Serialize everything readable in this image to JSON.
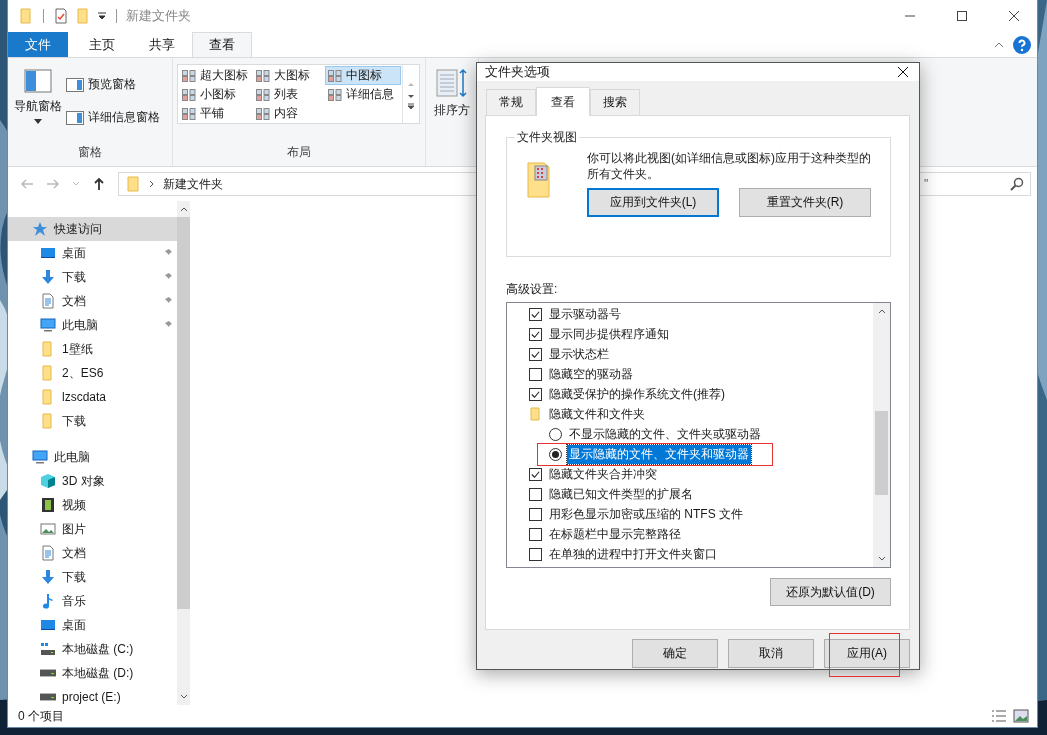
{
  "explorer": {
    "title": "新建文件夹",
    "ribbon_tabs": [
      {
        "label": "文件",
        "kind": "file",
        "selected": false
      },
      {
        "label": "主页",
        "kind": "tab",
        "selected": false
      },
      {
        "label": "共享",
        "kind": "tab",
        "selected": false
      },
      {
        "label": "查看",
        "kind": "tab",
        "selected": true
      }
    ],
    "panes_group": {
      "label": "窗格",
      "navigation_pane": "导航窗格",
      "items": [
        "预览窗格",
        "详细信息窗格"
      ]
    },
    "layout_group": {
      "label": "布局",
      "options": [
        {
          "label": "超大图标",
          "selected": false
        },
        {
          "label": "大图标",
          "selected": false
        },
        {
          "label": "中图标",
          "selected": true
        },
        {
          "label": "小图标",
          "selected": false
        },
        {
          "label": "列表",
          "selected": false
        },
        {
          "label": "详细信息",
          "selected": false
        },
        {
          "label": "平铺",
          "selected": false
        },
        {
          "label": "内容",
          "selected": false
        }
      ]
    },
    "sort_button": "排序方",
    "address": {
      "path": "新建文件夹"
    },
    "search": {
      "placeholder": "\""
    },
    "navigation": [
      {
        "label": "快速访问",
        "kind": "star",
        "selected": true,
        "pinned": false,
        "children": [
          {
            "label": "桌面",
            "kind": "desktop",
            "selected": false,
            "pinned": true
          },
          {
            "label": "下载",
            "kind": "download",
            "selected": false,
            "pinned": true
          },
          {
            "label": "文档",
            "kind": "document",
            "selected": false,
            "pinned": true
          },
          {
            "label": "此电脑",
            "kind": "pc",
            "selected": false,
            "pinned": true
          },
          {
            "label": "1壁纸",
            "kind": "folder",
            "selected": false,
            "pinned": false
          },
          {
            "label": "2、ES6",
            "kind": "folder",
            "selected": false,
            "pinned": false
          },
          {
            "label": "lzscdata",
            "kind": "folder",
            "selected": false,
            "pinned": false
          },
          {
            "label": "下载",
            "kind": "folder",
            "selected": false,
            "pinned": false
          }
        ]
      },
      {
        "label": "此电脑",
        "kind": "pc",
        "selected": false,
        "pinned": false,
        "children": [
          {
            "label": "3D 对象",
            "kind": "cube",
            "selected": false,
            "pinned": false
          },
          {
            "label": "视频",
            "kind": "video",
            "selected": false,
            "pinned": false
          },
          {
            "label": "图片",
            "kind": "picture",
            "selected": false,
            "pinned": false
          },
          {
            "label": "文档",
            "kind": "document",
            "selected": false,
            "pinned": false
          },
          {
            "label": "下载",
            "kind": "download",
            "selected": false,
            "pinned": false
          },
          {
            "label": "音乐",
            "kind": "music",
            "selected": false,
            "pinned": false
          },
          {
            "label": "桌面",
            "kind": "desktop",
            "selected": false,
            "pinned": false
          },
          {
            "label": "本地磁盘 (C:)",
            "kind": "system-drive",
            "selected": false,
            "pinned": false
          },
          {
            "label": "本地磁盘 (D:)",
            "kind": "drive",
            "selected": false,
            "pinned": false
          },
          {
            "label": "project (E:)",
            "kind": "drive",
            "selected": false,
            "pinned": false
          }
        ]
      }
    ],
    "status_bar": "0 个项目"
  },
  "dialog": {
    "title": "文件夹选项",
    "tabs": [
      {
        "label": "常规",
        "selected": false
      },
      {
        "label": "查看",
        "selected": true
      },
      {
        "label": "搜索",
        "selected": false
      }
    ],
    "folder_views": {
      "legend": "文件夹视图",
      "description": "你可以将此视图(如详细信息或图标)应用于这种类型的所有文件夹。",
      "buttons": [
        {
          "label": "应用到文件夹(L)",
          "focused": true
        },
        {
          "label": "重置文件夹(R)",
          "focused": false
        }
      ]
    },
    "advanced": {
      "label": "高级设置:",
      "items": [
        {
          "kind": "checkbox",
          "label": "显示驱动器号",
          "checked": true
        },
        {
          "kind": "checkbox",
          "label": "显示同步提供程序通知",
          "checked": true
        },
        {
          "kind": "checkbox",
          "label": "显示状态栏",
          "checked": true
        },
        {
          "kind": "checkbox",
          "label": "隐藏空的驱动器",
          "checked": false
        },
        {
          "kind": "checkbox",
          "label": "隐藏受保护的操作系统文件(推荐)",
          "checked": true
        },
        {
          "kind": "folder",
          "label": "隐藏文件和文件夹"
        },
        {
          "kind": "radio",
          "label": "不显示隐藏的文件、文件夹或驱动器",
          "selected": false,
          "highlighted": false
        },
        {
          "kind": "radio",
          "label": "显示隐藏的文件、文件夹和驱动器",
          "selected": true,
          "highlighted": true
        },
        {
          "kind": "checkbox",
          "label": "隐藏文件夹合并冲突",
          "checked": true
        },
        {
          "kind": "checkbox",
          "label": "隐藏已知文件类型的扩展名",
          "checked": false
        },
        {
          "kind": "checkbox",
          "label": "用彩色显示加密或压缩的 NTFS 文件",
          "checked": false
        },
        {
          "kind": "checkbox",
          "label": "在标题栏中显示完整路径",
          "checked": false
        },
        {
          "kind": "checkbox",
          "label": "在单独的进程中打开文件夹窗口",
          "checked": false
        }
      ]
    },
    "restore_button": "还原为默认值(D)",
    "buttons": [
      {
        "label": "确定",
        "highlighted": false
      },
      {
        "label": "取消",
        "highlighted": false
      },
      {
        "label": "应用(A)",
        "highlighted": true
      }
    ]
  }
}
